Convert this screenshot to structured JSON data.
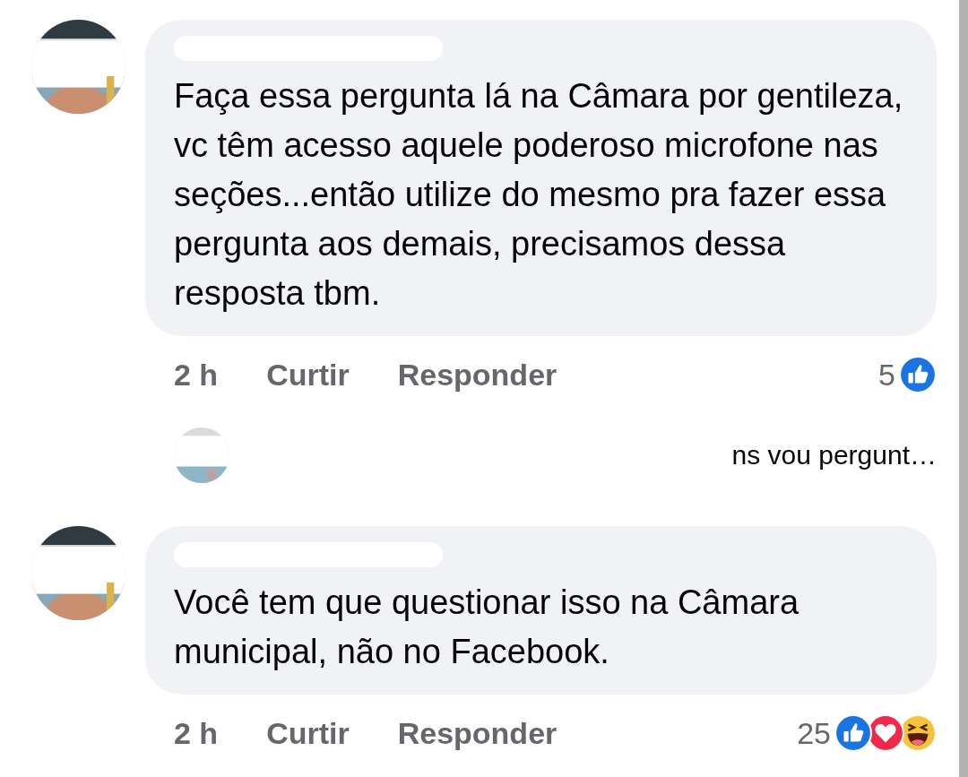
{
  "comments": [
    {
      "text": "Faça essa pergunta lá na Câmara por gentileza, vc têm acesso aquele poderoso microfone nas seções...então utilize do mesmo pra fazer essa pergunta aos demais,  precisamos dessa resposta tbm.",
      "time": "2 h",
      "like_label": "Curtir",
      "reply_label": "Responder",
      "reaction_count": "5",
      "reactions": [
        {
          "kind": "like"
        }
      ],
      "reply_preview": {
        "text": "ns vou pergunt…"
      }
    },
    {
      "text": "Você tem que questionar isso na Câmara municipal, não no Facebook.",
      "time": "2 h",
      "like_label": "Curtir",
      "reply_label": "Responder",
      "reaction_count": "25",
      "reactions": [
        {
          "kind": "like"
        },
        {
          "kind": "love"
        },
        {
          "kind": "haha"
        }
      ]
    }
  ]
}
